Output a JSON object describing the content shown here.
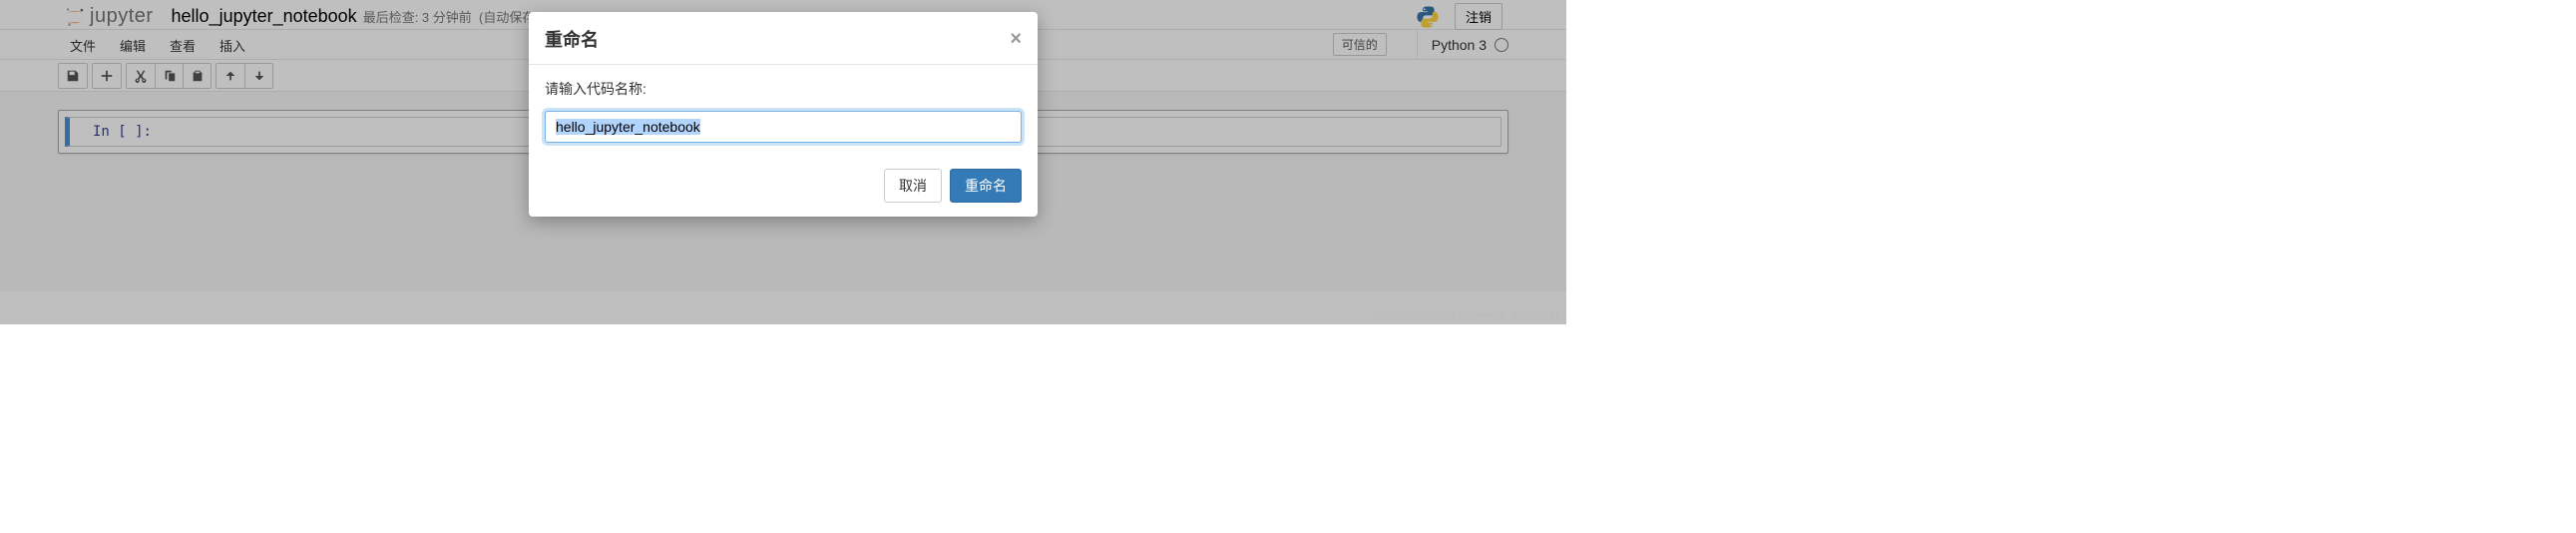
{
  "logo_text": "jupyter",
  "notebook_title": "hello_jupyter_notebook",
  "checkpoint_a": "最后检查: 3 分钟前",
  "checkpoint_b": "(自动保存)",
  "logout_label": "注销",
  "menus": {
    "file": "文件",
    "edit": "编辑",
    "view": "查看",
    "insert": "插入"
  },
  "trusted_label": "可信的",
  "kernel_name": "Python 3",
  "cell": {
    "prompt": "In [ ]:"
  },
  "modal": {
    "title": "重命名",
    "prompt_label": "请输入代码名称:",
    "input_value": "hello_jupyter_notebook",
    "cancel": "取消",
    "confirm": "重命名"
  },
  "credit": "https://blog.csdn.net/weixin_44650011"
}
